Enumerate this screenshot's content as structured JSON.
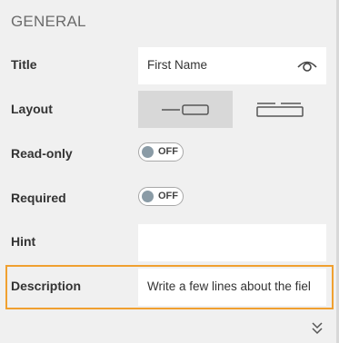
{
  "section": {
    "title": "GENERAL"
  },
  "rows": {
    "title": {
      "label": "Title",
      "value": "First Name"
    },
    "layout": {
      "label": "Layout"
    },
    "readonly": {
      "label": "Read-only",
      "toggle": "OFF"
    },
    "required": {
      "label": "Required",
      "toggle": "OFF"
    },
    "hint": {
      "label": "Hint",
      "value": ""
    },
    "description": {
      "label": "Description",
      "value": "Write a few lines about the fiel"
    }
  },
  "colors": {
    "highlight": "#f0a030",
    "toggle_knob": "#8a9ba6",
    "active_segment": "#d8d8d8"
  },
  "icons": {
    "visibility": "eye-icon",
    "expand": "double-chevron-down-icon"
  }
}
